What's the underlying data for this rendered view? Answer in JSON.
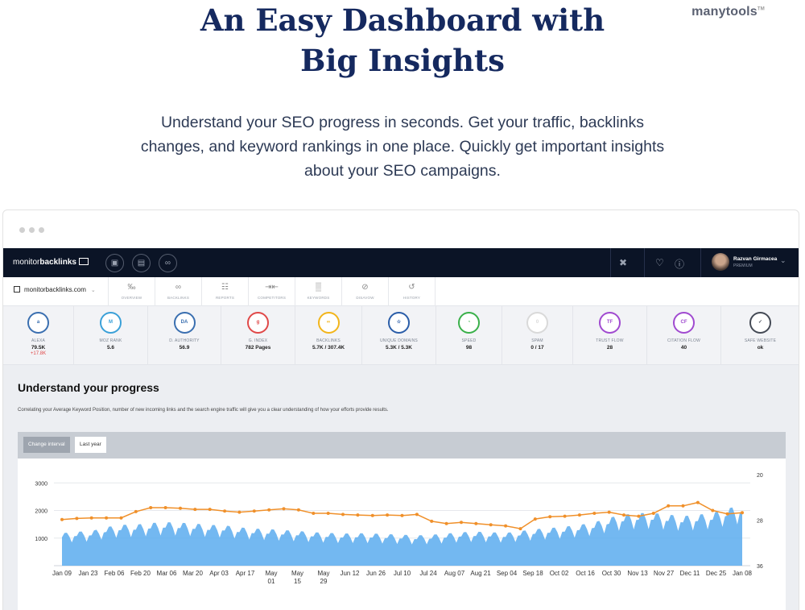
{
  "hero": {
    "title_line1": "An Easy Dashboard with",
    "title_line2": "Big Insights",
    "subtitle_line1": "Understand your SEO progress in seconds. Get your traffic, backlinks",
    "subtitle_line2": "changes, and keyword rankings in one place. Quickly get important insights",
    "subtitle_line3": "about your SEO campaigns."
  },
  "brand": {
    "name": "manytools",
    "tm": "TM"
  },
  "app": {
    "logo_light": "monitor",
    "logo_bold": "backlinks",
    "user_name": "Razvan Girmacea",
    "user_plan": "PREMIUM",
    "site": "monitorbacklinks.com",
    "nav": [
      {
        "label": "OVERVIEW",
        "icon": "glasses-icon",
        "glyph": "‰"
      },
      {
        "label": "BACKLINKS",
        "icon": "link-icon",
        "glyph": "∞"
      },
      {
        "label": "REPORTS",
        "icon": "report-icon",
        "glyph": "☷"
      },
      {
        "label": "COMPETITORS",
        "icon": "competitors-icon",
        "glyph": "⇥⇤"
      },
      {
        "label": "KEYWORDS",
        "icon": "keywords-icon",
        "glyph": "▒"
      },
      {
        "label": "DISAVOW",
        "icon": "disavow-icon",
        "glyph": "⊘"
      },
      {
        "label": "HISTORY",
        "icon": "history-icon",
        "glyph": "↺"
      }
    ],
    "metrics": [
      {
        "label": "ALEXA",
        "value": "79.5K",
        "delta": "+17.8K",
        "badge": "a",
        "color": "#3a6fb0"
      },
      {
        "label": "MOZ RANK",
        "value": "5.6",
        "delta": "",
        "badge": "M",
        "color": "#3aa0d8"
      },
      {
        "label": "D. AUTHORITY",
        "value": "56.9",
        "delta": "",
        "badge": "DA",
        "color": "#3a6fb0"
      },
      {
        "label": "G. INDEX",
        "value": "782 Pages",
        "delta": "",
        "badge": "g",
        "color": "#e04848"
      },
      {
        "label": "BACKLINKS",
        "value": "5.7K / 307.4K",
        "delta": "",
        "badge": "∞",
        "color": "#f2b51b"
      },
      {
        "label": "UNIQUE DOMAINS",
        "value": "5.3K / 5.3K",
        "delta": "",
        "badge": "☆",
        "color": "#2a5da8"
      },
      {
        "label": "SPEED",
        "value": "98",
        "delta": "",
        "badge": "◔",
        "color": "#3ab04a"
      },
      {
        "label": "SPAM",
        "value": "0 / 17",
        "delta": "",
        "badge": "0",
        "color": "#d9d9d9"
      },
      {
        "label": "TRUST FLOW",
        "value": "28",
        "delta": "",
        "badge": "TF",
        "color": "#a04ad0"
      },
      {
        "label": "CITATION FLOW",
        "value": "40",
        "delta": "",
        "badge": "CF",
        "color": "#a04ad0"
      },
      {
        "label": "SAFE WEBSITE",
        "value": "ok",
        "delta": "",
        "badge": "✓",
        "color": "#444a55"
      }
    ],
    "section_title": "Understand your progress",
    "section_desc": "Correlating your Average Keyword Position, number of new incoming links and the search engine traffic will give you a clear understanding of how your efforts provide results.",
    "interval_label": "Change interval",
    "interval_value": "Last year"
  },
  "colors": {
    "orange": "#f0902a",
    "blue": "#5aabef",
    "navy": "#15295f"
  },
  "chart_data": {
    "type": "line",
    "x_ticks": [
      "Jan 09",
      "Jan 23",
      "Feb 06",
      "Feb 20",
      "Mar 06",
      "Mar 20",
      "Apr 03",
      "Apr 17",
      "May 01",
      "May 15",
      "May 29",
      "Jun 12",
      "Jun 26",
      "Jul 10",
      "Jul 24",
      "Aug 07",
      "Aug 21",
      "Sep 04",
      "Sep 18",
      "Oct 02",
      "Oct 16",
      "Oct 30",
      "Nov 13",
      "Nov 27",
      "Dec 11",
      "Dec 25",
      "Jan 08"
    ],
    "y_left_ticks": [
      "1000",
      "2000",
      "3000"
    ],
    "y_left_range": [
      0,
      3300
    ],
    "y_right_ticks": [
      "20",
      "28",
      "36"
    ],
    "y_right_range": [
      20,
      36
    ],
    "y_right_inverted": true,
    "series": [
      {
        "type": "area",
        "axis": "left",
        "values": [
          1050,
          1100,
          1120,
          1250,
          1320,
          1330,
          1380,
          1410,
          1390,
          1360,
          1320,
          1300,
          1240,
          1200,
          1180,
          1150,
          1120,
          1080,
          1060,
          1040,
          1050,
          1040,
          1020,
          1000,
          980,
          1000,
          1040,
          1080,
          1100,
          1080,
          1060,
          1120,
          1180,
          1220,
          1260,
          1320,
          1400,
          1550,
          1650,
          1700,
          1700,
          1650,
          1600,
          1650,
          1700,
          1850,
          1950
        ]
      },
      {
        "type": "line",
        "axis": "right",
        "values": [
          27.9,
          27.7,
          27.6,
          27.6,
          27.6,
          26.5,
          25.8,
          25.8,
          25.9,
          26.1,
          26.1,
          26.4,
          26.6,
          26.4,
          26.2,
          26.0,
          26.2,
          26.8,
          26.8,
          27.0,
          27.1,
          27.2,
          27.1,
          27.2,
          27.0,
          28.2,
          28.6,
          28.4,
          28.6,
          28.8,
          29.0,
          29.5,
          27.8,
          27.4,
          27.3,
          27.1,
          26.8,
          26.6,
          27.1,
          27.3,
          26.8,
          25.5,
          25.5,
          24.9,
          26.3,
          26.9,
          26.7
        ]
      }
    ]
  }
}
